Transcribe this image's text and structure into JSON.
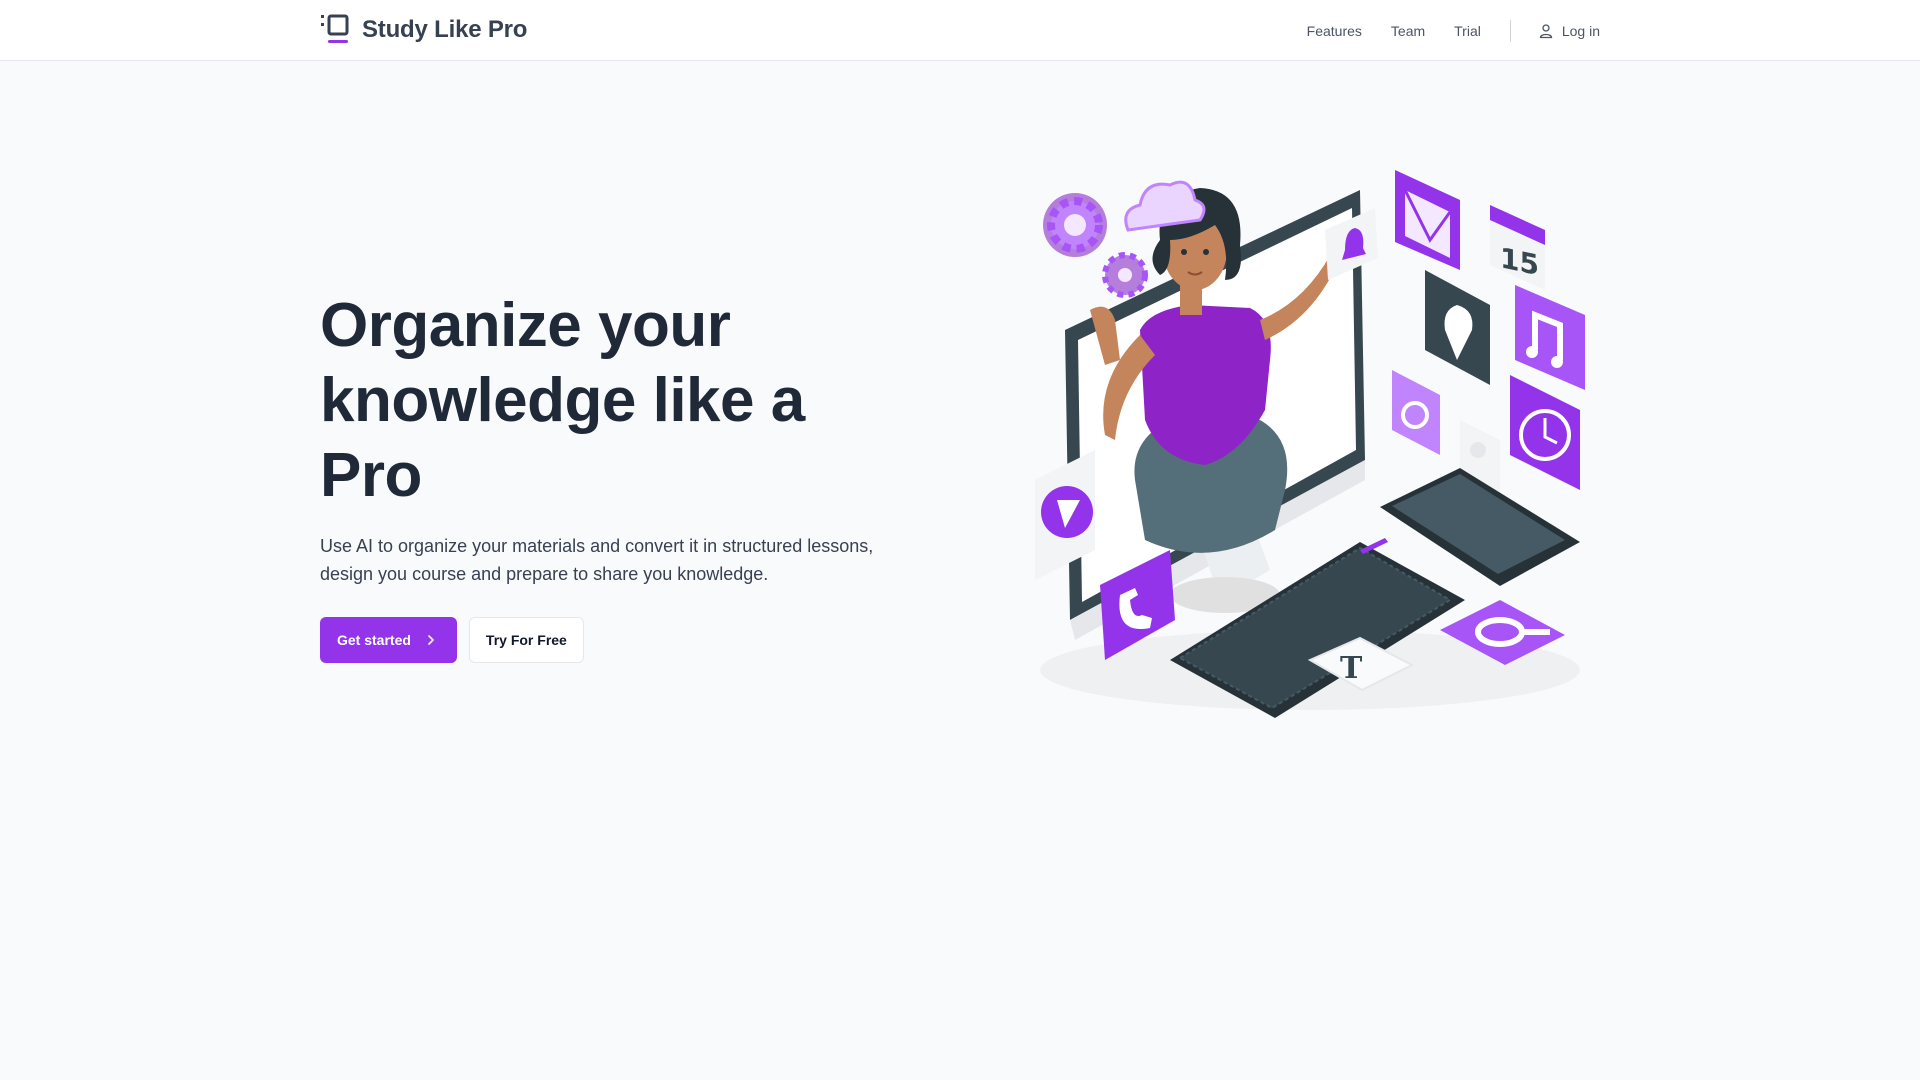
{
  "header": {
    "brand": "Study Like Pro",
    "nav": {
      "features": "Features",
      "team": "Team",
      "trial": "Trial",
      "login": "Log in"
    }
  },
  "hero": {
    "headline_line1": "Organize your",
    "headline_line2": "knowledge like a Pro",
    "subtitle_line1": "Use AI to organize your materials and convert it in structured lessons,",
    "subtitle_line2": "design you course and prepare to share you knowledge.",
    "primary_cta": "Get started",
    "secondary_cta": "Try For Free"
  },
  "illustration": {
    "calendar_day": "15",
    "letter_tile": "T"
  },
  "colors": {
    "accent": "#9333ea",
    "accent_light": "#c084fc",
    "dark": "#37474f",
    "skin": "#c4845c"
  }
}
